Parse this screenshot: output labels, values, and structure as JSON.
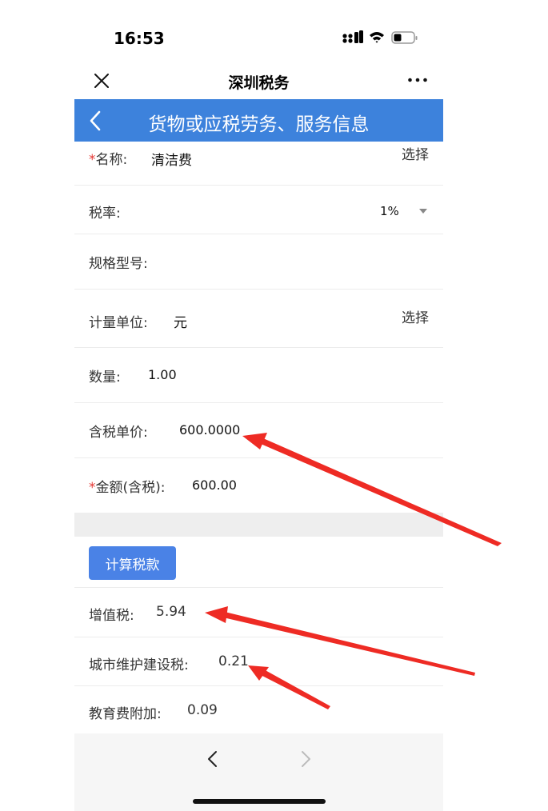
{
  "status_bar": {
    "time": "16:53"
  },
  "nav": {
    "title": "深圳税务"
  },
  "header": {
    "title": "货物或应税劳务、服务信息"
  },
  "form": {
    "name": {
      "required_mark": "*",
      "label": "名称:",
      "value": "清洁费",
      "action": "选择"
    },
    "tax_rate": {
      "label": "税率:",
      "value": "1%"
    },
    "spec": {
      "label": "规格型号:",
      "value": ""
    },
    "unit": {
      "label": "计量单位:",
      "value": "元",
      "action": "选择"
    },
    "quantity": {
      "label": "数量:",
      "value": "1.00"
    },
    "unit_price": {
      "label": "含税单价:",
      "value": "600.0000"
    },
    "amount": {
      "required_mark": "*",
      "label": "金额(含税):",
      "value": "600.00"
    }
  },
  "calc_button": {
    "label": "计算税款"
  },
  "taxes": {
    "vat": {
      "label": "增值税:",
      "value": "5.94"
    },
    "city_tax": {
      "label": "城市维护建设税:",
      "value": "0.21"
    },
    "edu_fee": {
      "label": "教育费附加:",
      "value": "0.09"
    }
  },
  "colors": {
    "header_bg": "#3d82dc",
    "button_bg": "#4a82e6",
    "required": "#e53935",
    "annotation_arrow": "#ee2b24"
  }
}
